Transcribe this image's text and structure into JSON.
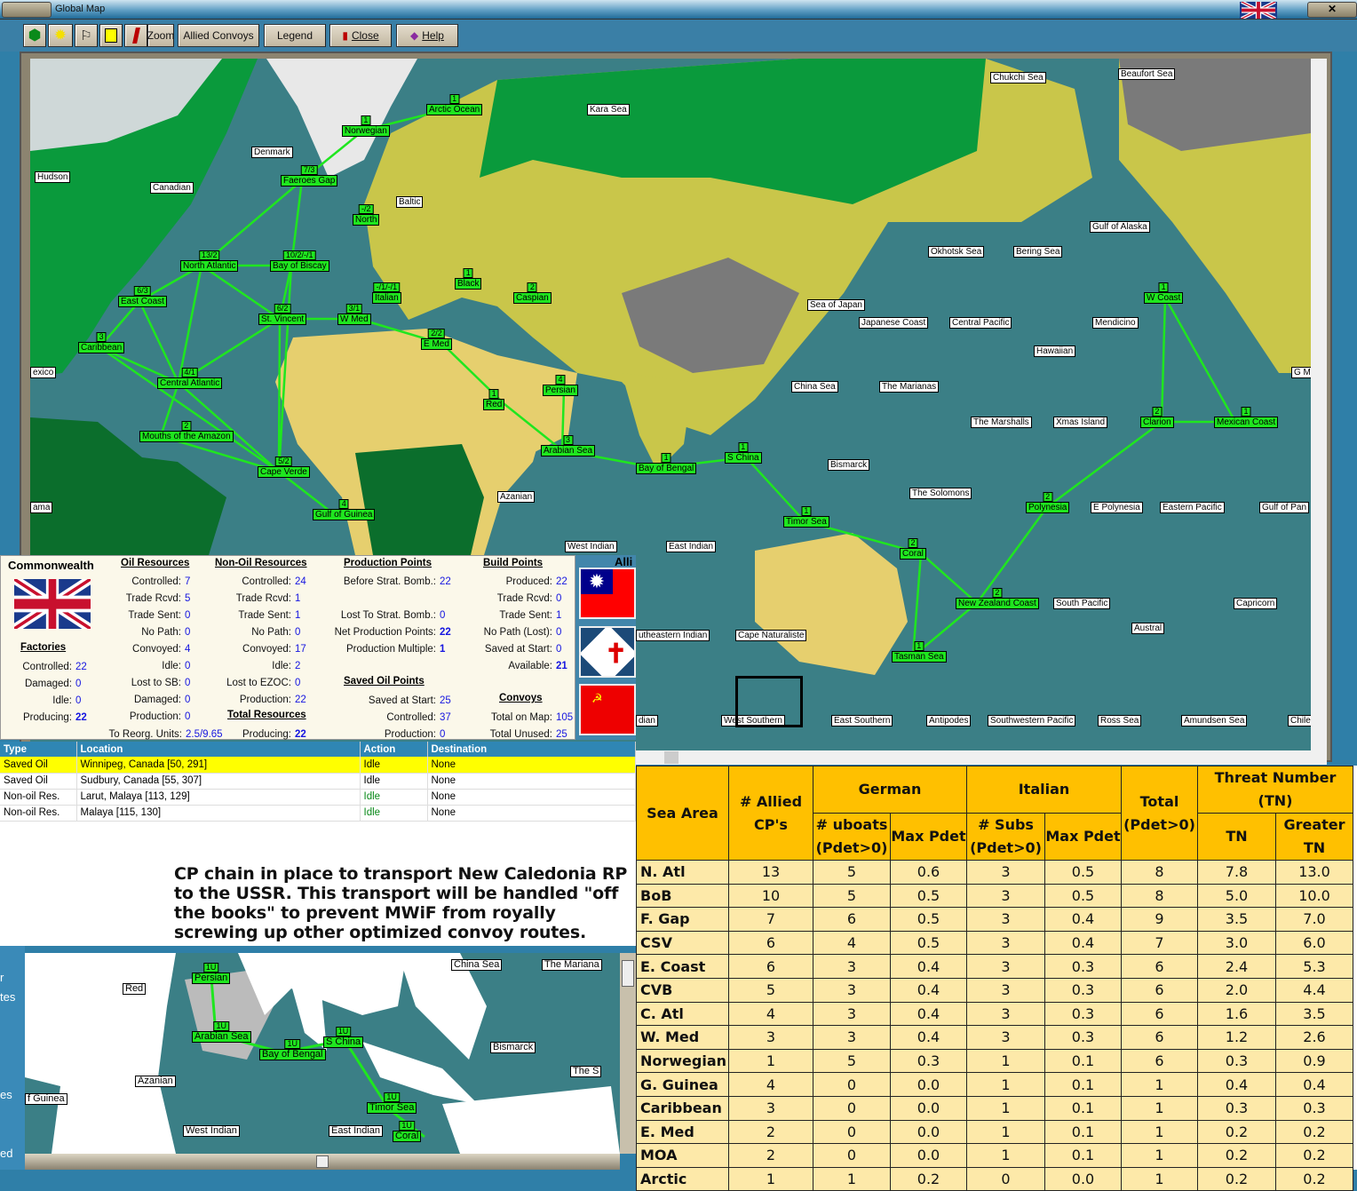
{
  "window": {
    "title": "Global Map"
  },
  "toolbar": {
    "icons": [
      "hex-icon",
      "sun-icon",
      "flag-icon",
      "calculator-icon",
      "pen-icon"
    ],
    "zoom": "Zoom",
    "allied_convoys": "Allied Convoys",
    "legend": "Legend",
    "close": "Close",
    "help": "Help"
  },
  "colors": {
    "sea": "#3b7f86",
    "convoy": "#1fe61f",
    "land_desert": "#e6cf6e",
    "land_forest": "#0a9a3c",
    "header": "#ffc000",
    "cell": "#fde9a9",
    "highlight": "#ffff00"
  },
  "map": {
    "convoy_areas": [
      {
        "name": "Arctic Ocean",
        "count": "1"
      },
      {
        "name": "Norwegian",
        "count": "1"
      },
      {
        "name": "Faeroes Gap",
        "count": "7/3"
      },
      {
        "name": "North",
        "count": "-/2"
      },
      {
        "name": "North Atlantic",
        "count": "13/2"
      },
      {
        "name": "Bay of Biscay",
        "count": "10/2/-/1"
      },
      {
        "name": "East Coast",
        "count": "6/3"
      },
      {
        "name": "Caribbean",
        "count": "3"
      },
      {
        "name": "St. Vincent",
        "count": "6/2"
      },
      {
        "name": "W Med",
        "count": "3/1"
      },
      {
        "name": "Italian",
        "count": "-/1/-/1"
      },
      {
        "name": "Black",
        "count": "1"
      },
      {
        "name": "Caspian",
        "count": "2"
      },
      {
        "name": "E Med",
        "count": "2/2"
      },
      {
        "name": "Central Atlantic",
        "count": "4/1"
      },
      {
        "name": "Red",
        "count": "1"
      },
      {
        "name": "Persian",
        "count": "4"
      },
      {
        "name": "Mouths of the Amazon",
        "count": "2"
      },
      {
        "name": "Arabian Sea",
        "count": "3"
      },
      {
        "name": "Cape Verde",
        "count": "5/2"
      },
      {
        "name": "Gulf of Guinea",
        "count": "4"
      },
      {
        "name": "Bay of Bengal",
        "count": "1"
      },
      {
        "name": "S China",
        "count": "1"
      },
      {
        "name": "Timor Sea",
        "count": "1"
      },
      {
        "name": "Coral",
        "count": "2"
      },
      {
        "name": "Tasman Sea",
        "count": "1"
      },
      {
        "name": "New Zealand Coast",
        "count": "2"
      },
      {
        "name": "Polynesia",
        "count": "2"
      },
      {
        "name": "Clarion",
        "count": "2"
      },
      {
        "name": "Mexican Coast",
        "count": "1"
      },
      {
        "name": "W Coast",
        "count": "1"
      }
    ],
    "sea_areas": [
      "Chukchi Sea",
      "Beaufort Sea",
      "Kara Sea",
      "Denmark",
      "Hudson",
      "Canadian",
      "Baltic",
      "Gulf of Alaska",
      "Okhotsk Sea",
      "Bering Sea",
      "Sea of Japan",
      "Japanese Coast",
      "Central Pacific",
      "Mendicino",
      "Hawaiian",
      "exico",
      "G M",
      "China Sea",
      "The Marianas",
      "The Marshalls",
      "Xmas Island",
      "Bismarck",
      "The Solomons",
      "Azanian",
      "ama",
      "E Polynesia",
      "Eastern Pacific",
      "Gulf of Pan",
      "West Indian",
      "East Indian",
      "South Pacific",
      "Capricorn",
      "Austral",
      "utheastern Indian",
      "Cape Naturaliste",
      "dian",
      "West Southern",
      "East Southern",
      "Antipodes",
      "Southwestern Pacific",
      "Ross Sea",
      "Amundsen Sea",
      "Chile"
    ]
  },
  "panel": {
    "title": "Commonwealth",
    "allies_label": "Alli",
    "factories": {
      "header": "Factories",
      "rows": [
        {
          "label": "Controlled:",
          "value": "22"
        },
        {
          "label": "Damaged:",
          "value": "0"
        },
        {
          "label": "Idle:",
          "value": "0"
        },
        {
          "label": "Producing:",
          "value": "22",
          "bold": true
        }
      ]
    },
    "oil": {
      "header": "Oil Resources",
      "rows": [
        {
          "label": "Controlled:",
          "value": "7"
        },
        {
          "label": "Trade Rcvd:",
          "value": "5"
        },
        {
          "label": "Trade Sent:",
          "value": "0"
        },
        {
          "label": "No Path:",
          "value": "0"
        },
        {
          "label": "Convoyed:",
          "value": "4"
        },
        {
          "label": "Idle:",
          "value": "0"
        },
        {
          "label": "Lost to SB:",
          "value": "0"
        },
        {
          "label": "Damaged:",
          "value": "0"
        },
        {
          "label": "Production:",
          "value": "0"
        }
      ]
    },
    "nonoil": {
      "header": "Non-Oil Resources",
      "rows": [
        {
          "label": "Controlled:",
          "value": "24"
        },
        {
          "label": "Trade Rcvd:",
          "value": "1"
        },
        {
          "label": "Trade Sent:",
          "value": "1"
        },
        {
          "label": "No Path:",
          "value": "0"
        },
        {
          "label": "Convoyed:",
          "value": "17"
        },
        {
          "label": "Idle:",
          "value": "2"
        },
        {
          "label": "Lost to EZOC:",
          "value": "0"
        },
        {
          "label": "Production:",
          "value": "22"
        }
      ]
    },
    "reorg": {
      "label": "To Reorg. Units:",
      "value": "2.5/9.65"
    },
    "total_resources": {
      "header": "Total Resources",
      "rows": [
        {
          "label": "Producing:",
          "value": "22",
          "bold": true
        }
      ]
    },
    "production": {
      "header": "Production Points",
      "rows": [
        {
          "label": "Before Strat. Bomb.:",
          "value": "22"
        },
        {
          "label": "",
          "value": ""
        },
        {
          "label": "Lost To Strat. Bomb.:",
          "value": "0"
        },
        {
          "label": "Net Production Points:",
          "value": "22",
          "bold": true
        },
        {
          "label": "Production Multiple:",
          "value": "1",
          "bold": true
        }
      ]
    },
    "saved_oil": {
      "header": "Saved Oil Points",
      "rows": [
        {
          "label": "Saved at Start:",
          "value": "25"
        },
        {
          "label": "Controlled:",
          "value": "37"
        },
        {
          "label": "Production:",
          "value": "0"
        }
      ]
    },
    "build": {
      "header": "Build Points",
      "rows": [
        {
          "label": "Produced:",
          "value": "22"
        },
        {
          "label": "Trade Rcvd:",
          "value": "0"
        },
        {
          "label": "Trade Sent:",
          "value": "1"
        },
        {
          "label": "No Path (Lost):",
          "value": "0"
        },
        {
          "label": "Saved at Start:",
          "value": "0"
        },
        {
          "label": "Available:",
          "value": "21",
          "bold": true
        }
      ]
    },
    "convoys": {
      "header": "Convoys",
      "rows": [
        {
          "label": "Total on Map:",
          "value": "105"
        },
        {
          "label": "Total Unused:",
          "value": "25"
        }
      ]
    }
  },
  "list": {
    "headers": [
      "Type",
      "Location",
      "Action",
      "Destination"
    ],
    "rows": [
      {
        "type": "Saved Oil",
        "location": "Winnipeg, Canada [50, 291]",
        "action": "Idle",
        "destination": "None",
        "selected": true
      },
      {
        "type": "Saved Oil",
        "location": "Sudbury, Canada [55, 307]",
        "action": "Idle",
        "destination": "None"
      },
      {
        "type": "Non-oil Res.",
        "location": "Larut, Malaya [113, 129]",
        "action": "Idle",
        "destination": "None",
        "green": true
      },
      {
        "type": "Non-oil Res.",
        "location": "Malaya [115, 130]",
        "action": "Idle",
        "destination": "None",
        "green": true
      }
    ]
  },
  "caption": [
    "CP chain in place to transport New Caledonia RP",
    "to the USSR.   This transport will be handled \"off",
    "the books\" to prevent MWiF from royally",
    "screwing up other optimized convoy routes."
  ],
  "minimap": {
    "side_text": [
      "r",
      "tes",
      "es",
      "ed"
    ],
    "convoy_areas": [
      {
        "name": "Persian",
        "count": "1U"
      },
      {
        "name": "Arabian Sea",
        "count": "1U"
      },
      {
        "name": "Bay of Bengal",
        "count": "1U"
      },
      {
        "name": "S China",
        "count": "1U"
      },
      {
        "name": "Timor Sea",
        "count": "1U"
      },
      {
        "name": "Coral",
        "count": "1U"
      }
    ],
    "sea_areas": [
      "Red",
      "Azanian",
      "f Guinea",
      "West Indian",
      "East Indian",
      "China Sea",
      "The Mariana",
      "Bismarck",
      "The S"
    ]
  },
  "sea_table": {
    "headers": {
      "sea_area": "Sea Area",
      "allied": "# Allied CP's",
      "german": "German",
      "italian": "Italian",
      "total": "Total (Pdet>0)",
      "threat": "Threat Number (TN)",
      "uboats": "# uboats (Pdet>0)",
      "max_pdet": "Max Pdet",
      "subs": "# Subs (Pdet>0)",
      "tn": "TN",
      "greater_tn": "Greater TN"
    },
    "rows": [
      [
        "N. Atl",
        "13",
        "5",
        "0.6",
        "3",
        "0.5",
        "8",
        "7.8",
        "13.0"
      ],
      [
        "BoB",
        "10",
        "5",
        "0.5",
        "3",
        "0.5",
        "8",
        "5.0",
        "10.0"
      ],
      [
        "F. Gap",
        "7",
        "6",
        "0.5",
        "3",
        "0.4",
        "9",
        "3.5",
        "7.0"
      ],
      [
        "CSV",
        "6",
        "4",
        "0.5",
        "3",
        "0.4",
        "7",
        "3.0",
        "6.0"
      ],
      [
        "E. Coast",
        "6",
        "3",
        "0.4",
        "3",
        "0.3",
        "6",
        "2.4",
        "5.3"
      ],
      [
        "CVB",
        "5",
        "3",
        "0.4",
        "3",
        "0.3",
        "6",
        "2.0",
        "4.4"
      ],
      [
        "C. Atl",
        "4",
        "3",
        "0.4",
        "3",
        "0.3",
        "6",
        "1.6",
        "3.5"
      ],
      [
        "W. Med",
        "3",
        "3",
        "0.4",
        "3",
        "0.3",
        "6",
        "1.2",
        "2.6"
      ],
      [
        "Norwegian",
        "1",
        "5",
        "0.3",
        "1",
        "0.1",
        "6",
        "0.3",
        "0.9"
      ],
      [
        "G. Guinea",
        "4",
        "0",
        "0.0",
        "1",
        "0.1",
        "1",
        "0.4",
        "0.4"
      ],
      [
        "Caribbean",
        "3",
        "0",
        "0.0",
        "1",
        "0.1",
        "1",
        "0.3",
        "0.3"
      ],
      [
        "E. Med",
        "2",
        "0",
        "0.0",
        "1",
        "0.1",
        "1",
        "0.2",
        "0.2"
      ],
      [
        "MOA",
        "2",
        "0",
        "0.0",
        "1",
        "0.1",
        "1",
        "0.2",
        "0.2"
      ],
      [
        "Arctic",
        "1",
        "1",
        "0.2",
        "0",
        "0.0",
        "1",
        "0.2",
        "0.2"
      ]
    ]
  }
}
